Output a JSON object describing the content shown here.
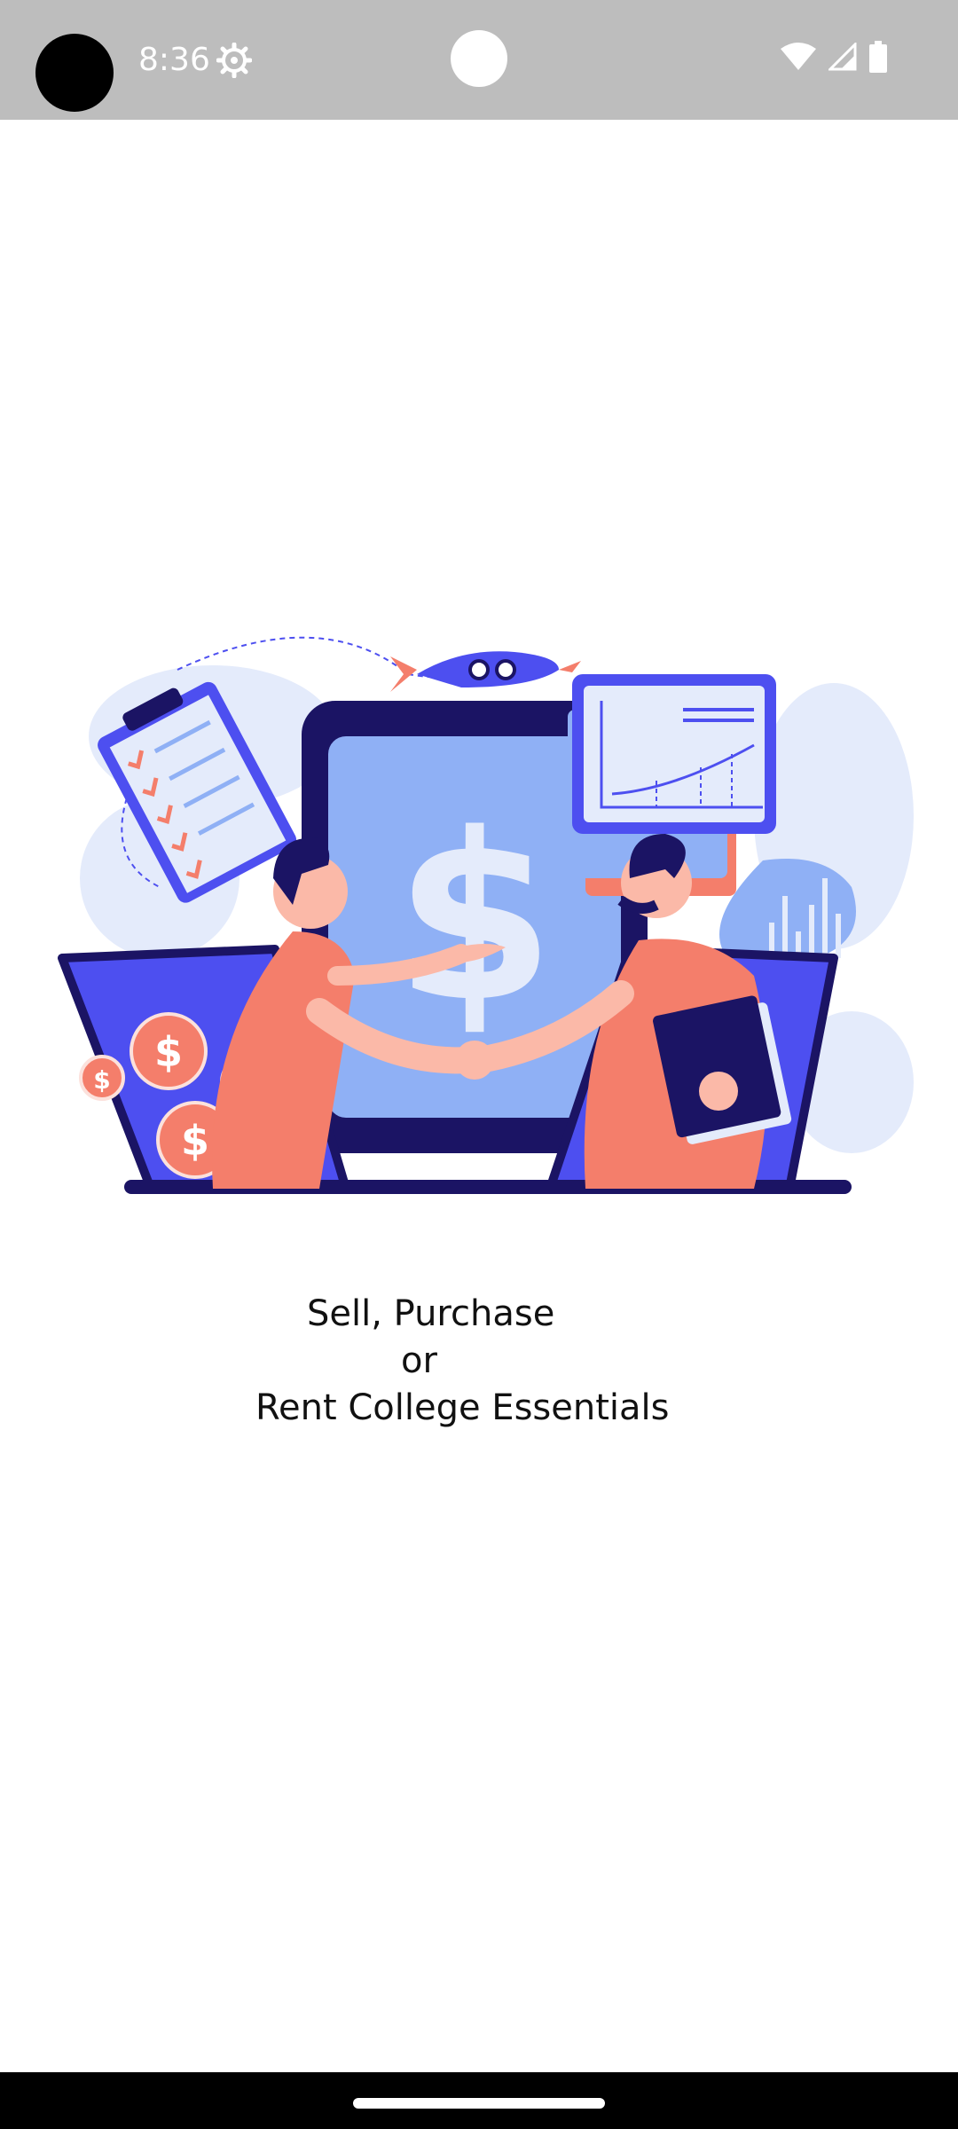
{
  "status_bar": {
    "time": "8:36",
    "icons": [
      "settings-icon",
      "wifi-icon",
      "signal-icon",
      "battery-icon"
    ]
  },
  "onboarding": {
    "illustration": "handshake-over-laptop-illustration",
    "tagline": {
      "line1": "Sell, Purchase",
      "line2": "or",
      "line3": "Rent College Essentials"
    }
  },
  "colors": {
    "status_bar_bg": "#bdbdbd",
    "navy": "#1b1464",
    "screen_blue": "#8fb0f5",
    "accent_blue": "#4d4ff0",
    "salmon": "#f47e6b",
    "light_blue_bg": "#e4ebfb"
  },
  "nav_bar": {
    "home_indicator": "home-indicator"
  }
}
